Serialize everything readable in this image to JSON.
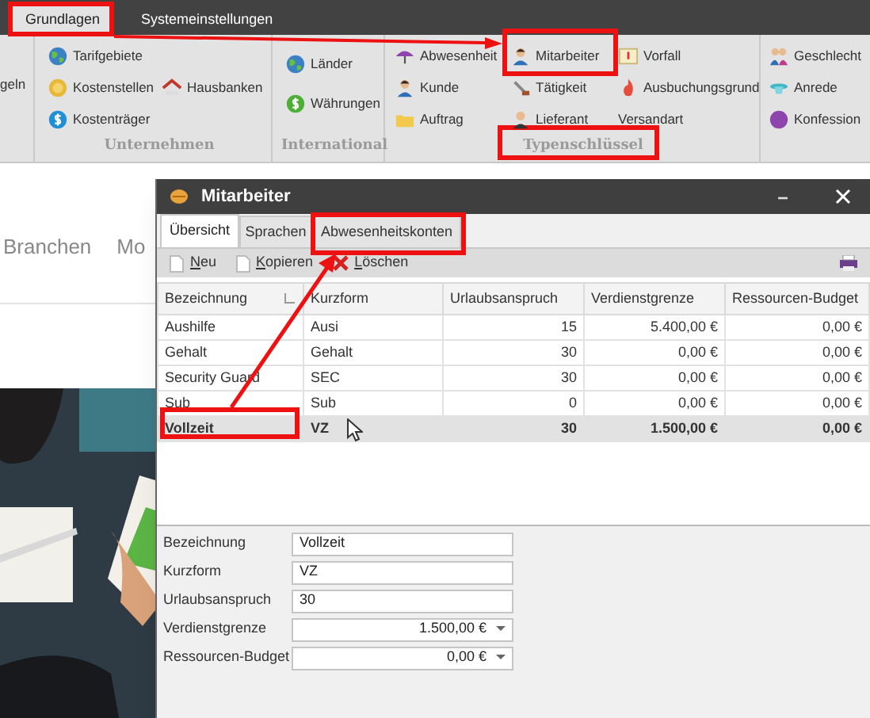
{
  "top_tabs": [
    {
      "label": "Grundlagen",
      "selected": true
    },
    {
      "label": "Systemeinstellungen",
      "selected": false
    }
  ],
  "ribbon": {
    "groups": [
      {
        "columns": [
          [
            {
              "label": "geln"
            }
          ]
        ]
      },
      {
        "label": "Unternehmen",
        "columns": [
          [
            {
              "label": "Tarifgebiete"
            },
            {
              "label": "Kostenstellen"
            },
            {
              "label": "Kostenträger"
            }
          ],
          [
            {
              "label": "Hausbanken"
            }
          ]
        ]
      },
      {
        "label": "International",
        "columns": [
          [
            {
              "label": "Länder"
            },
            {
              "label": "Währungen"
            }
          ]
        ]
      },
      {
        "label": "Typenschlüssel",
        "columns": [
          [
            {
              "label": "Abwesenheit"
            },
            {
              "label": "Kunde"
            },
            {
              "label": "Auftrag"
            }
          ],
          [
            {
              "label": "Mitarbeiter"
            },
            {
              "label": "Tätigkeit"
            },
            {
              "label": "Lieferant"
            }
          ],
          [
            {
              "label": "Vorfall"
            },
            {
              "label": "Ausbuchungsgrund"
            },
            {
              "label": "Versandart"
            }
          ]
        ]
      },
      {
        "columns": [
          [
            {
              "label": "Geschlecht"
            },
            {
              "label": "Anrede"
            },
            {
              "label": "Konfession"
            }
          ]
        ]
      }
    ]
  },
  "page": {
    "nav": [
      "Branchen",
      "Mo"
    ],
    "image": {
      "kind": "picture"
    }
  },
  "dialog": {
    "title": "Mitarbeiter",
    "tabs": [
      {
        "label": "Übersicht",
        "selected": true
      },
      {
        "label": "Sprachen",
        "selected": false
      },
      {
        "label": "Abwesenheitskonten",
        "selected": false
      }
    ],
    "toolbar": [
      "Neu",
      "Kopieren",
      "Löschen"
    ],
    "table": {
      "columns": [
        "Bezeichnung",
        "Kurzform",
        "Urlaubsanspruch",
        "Verdienstgrenze",
        "Ressourcen-Budget"
      ],
      "rows": [
        {
          "cells": [
            "Aushilfe",
            "Ausi",
            "15",
            "5.400,00 €",
            "0,00 €"
          ],
          "selected": false
        },
        {
          "cells": [
            "Gehalt",
            "Gehalt",
            "30",
            "0,00 €",
            "0,00 €"
          ],
          "selected": false
        },
        {
          "cells": [
            "Security Guard",
            "SEC",
            "30",
            "0,00 €",
            "0,00 €"
          ],
          "selected": false
        },
        {
          "cells": [
            "Sub",
            "Sub",
            "0",
            "0,00 €",
            "0,00 €"
          ],
          "selected": false
        },
        {
          "cells": [
            "Vollzeit",
            "VZ",
            "30",
            "1.500,00 €",
            "0,00 €"
          ],
          "selected": true
        }
      ]
    },
    "form": [
      {
        "label": "Bezeichnung",
        "value": "Vollzeit",
        "kind": "text"
      },
      {
        "label": "Kurzform",
        "value": "VZ",
        "kind": "text"
      },
      {
        "label": "Urlaubsanspruch",
        "value": "30",
        "kind": "text"
      },
      {
        "label": "Verdienstgrenze",
        "value": "1.500,00 €",
        "kind": "currency"
      },
      {
        "label": "Ressourcen-Budget",
        "value": "0,00 €",
        "kind": "currency"
      }
    ]
  }
}
